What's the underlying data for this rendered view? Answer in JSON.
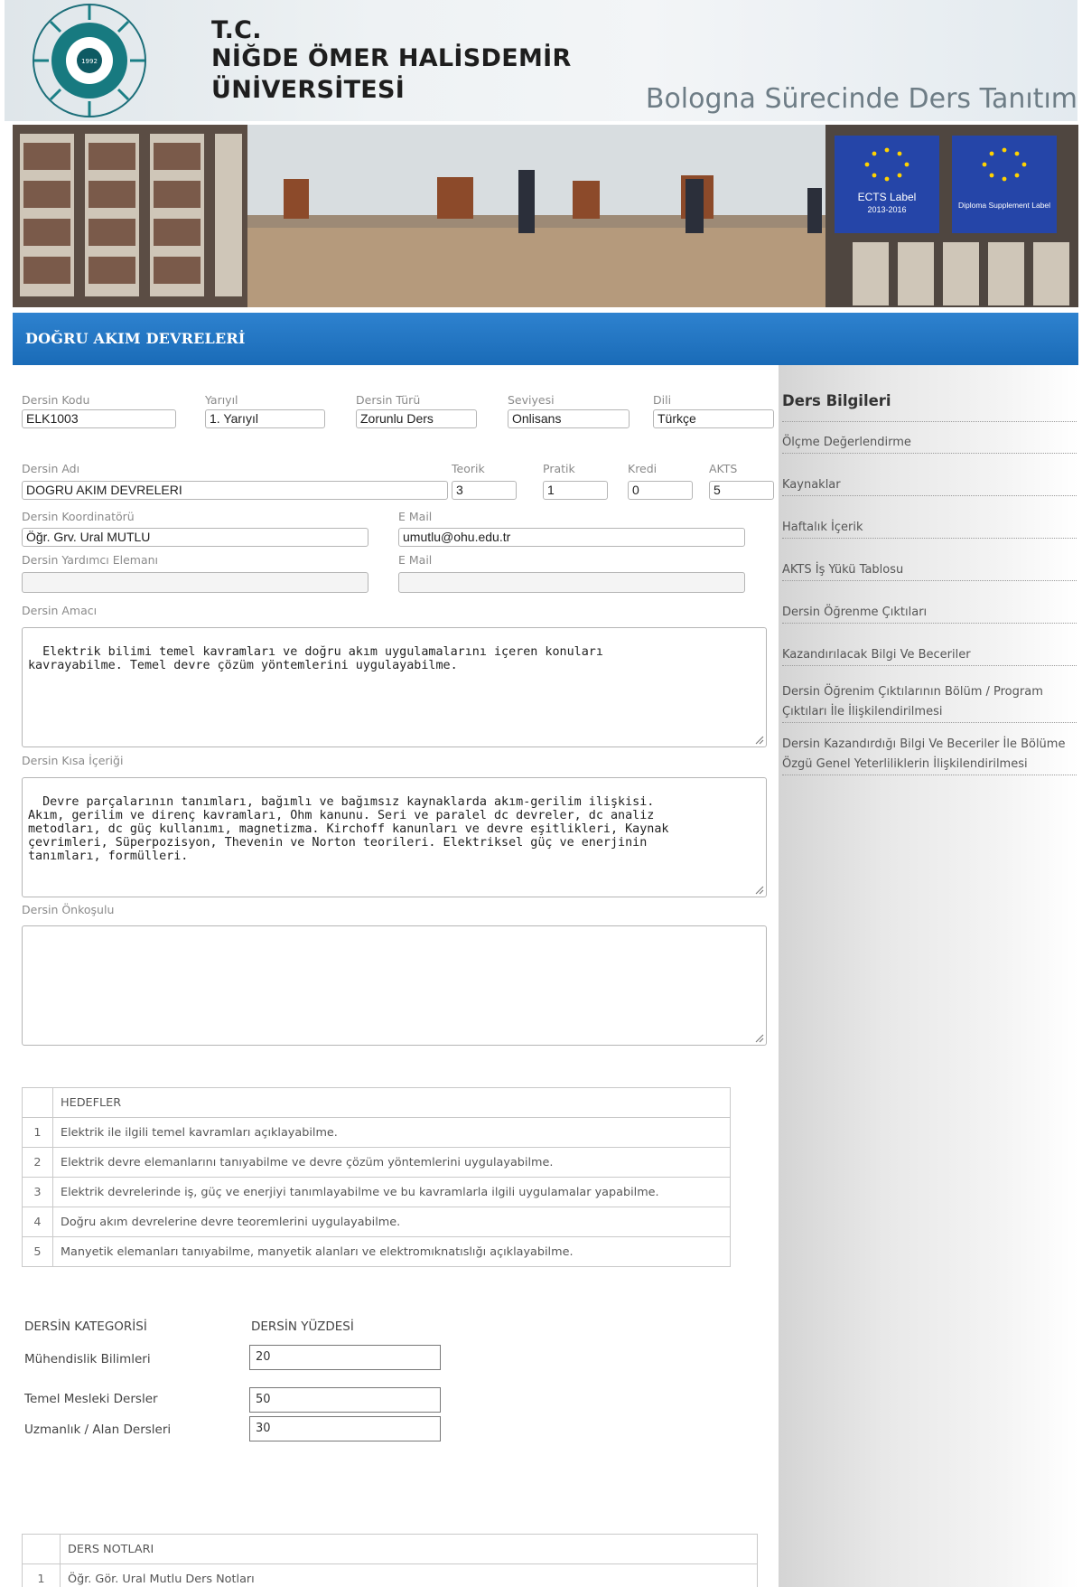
{
  "header": {
    "tc": "T.C.",
    "university_line1": "NİĞDE ÖMER HALİSDEMİR",
    "university_line2": "ÜNİVERSİTESİ",
    "bologna": "Bologna Sürecinde Ders Tanıtım",
    "logo_text": "NİĞDE ÖMER HALİSDEMİR ÜNİVERSİTESİ",
    "logo_year": "1992"
  },
  "banner": {
    "ects_label": "ECTS Label",
    "ects_years": "2013-2016",
    "ds_label": "Diploma Supplement Label"
  },
  "page_title": "DOĞRU AKIM DEVRELERİ",
  "form": {
    "kod_label": "Dersin Kodu",
    "kod": "ELK1003",
    "yariyil_label": "Yarıyıl",
    "yariyil": "1. Yarıyıl",
    "tur_label": "Dersin Türü",
    "tur": "Zorunlu Ders",
    "seviye_label": "Seviyesi",
    "seviye": "Onlisans",
    "dil_label": "Dili",
    "dil": "Türkçe",
    "ad_label": "Dersin Adı",
    "ad": "DOGRU AKIM DEVRELERI",
    "teorik_label": "Teorik",
    "teorik": "3",
    "pratik_label": "Pratik",
    "pratik": "1",
    "kredi_label": "Kredi",
    "kredi": "0",
    "akts_label": "AKTS",
    "akts": "5",
    "koord_label": "Dersin Koordinatörü",
    "koord": "Öğr. Grv. Ural MUTLU",
    "email_label": "E Mail",
    "email": "umutlu@ohu.edu.tr",
    "yard_label": "Dersin Yardımcı Elemanı",
    "yard": "",
    "email2_label": "E Mail",
    "email2": "",
    "amac_label": "Dersin Amacı",
    "amac": "Elektrik bilimi temel kavramları ve doğru akım uygulamalarını içeren konuları\nkavrayabilme. Temel devre çözüm yöntemlerini uygulayabilme.",
    "icerik_label": "Dersin Kısa İçeriği",
    "icerik": "Devre parçalarının tanımları, bağımlı ve bağımsız kaynaklarda akım-gerilim ilişkisi.\nAkım, gerilim ve direnç kavramları, Ohm kanunu. Seri ve paralel dc devreler, dc analiz\nmetodları, dc güç kullanımı, magnetizma. Kirchoff kanunları ve devre eşitlikleri, Kaynak\nçevrimleri, Süperpozisyon, Thevenin ve Norton teorileri. Elektriksel güç ve enerjinin\ntanımları, formülleri.",
    "onkosul_label": "Dersin Önkoşulu",
    "onkosul": ""
  },
  "hedefler": {
    "header": "HEDEFLER",
    "rows": [
      {
        "n": "1",
        "text": "Elektrik ile ilgili temel kavramları açıklayabilme."
      },
      {
        "n": "2",
        "text": "Elektrik devre elemanlarını tanıyabilme ve devre çözüm yöntemlerini uygulayabilme."
      },
      {
        "n": "3",
        "text": "Elektrik devrelerinde iş, güç ve enerjiyi tanımlayabilme ve bu kavramlarla ilgili uygulamalar yapabilme."
      },
      {
        "n": "4",
        "text": "Doğru akım devrelerine devre teoremlerini uygulayabilme."
      },
      {
        "n": "5",
        "text": "Manyetik elemanları tanıyabilme, manyetik alanları ve elektromıknatıslığı açıklayabilme."
      }
    ]
  },
  "kategori": {
    "h1": "DERSİN KATEGORİSİ",
    "h2": "DERSİN YÜZDESİ",
    "rows": [
      {
        "name": "Mühendislik Bilimleri",
        "value": "20"
      },
      {
        "name": "Temel Mesleki Dersler",
        "value": "50"
      },
      {
        "name": "Uzmanlık / Alan Dersleri",
        "value": "30"
      }
    ]
  },
  "notlar": {
    "header": "DERS NOTLARI",
    "rows": [
      {
        "n": "1",
        "text": "Öğr. Gör. Ural Mutlu Ders Notları"
      }
    ]
  },
  "sidebar": {
    "title": "Ders Bilgileri",
    "items": [
      "Ölçme Değerlendirme",
      "Kaynaklar",
      "Haftalık İçerik",
      "AKTS İş Yükü Tablosu",
      "Dersin Öğrenme Çıktıları",
      "Kazandırılacak Bilgi Ve Beceriler",
      "Dersin Öğrenim Çıktılarının Bölüm / Program Çıktıları İle İlişkilendirilmesi",
      "Dersin Kazandırdığı Bilgi Ve Beceriler İle Bölüme Özgü Genel Yeterliliklerin İlişkilendirilmesi"
    ]
  },
  "colors": {
    "title_bar": "#1f70bd",
    "eu_blue": "#2545a8",
    "eu_star": "#ffd200"
  }
}
